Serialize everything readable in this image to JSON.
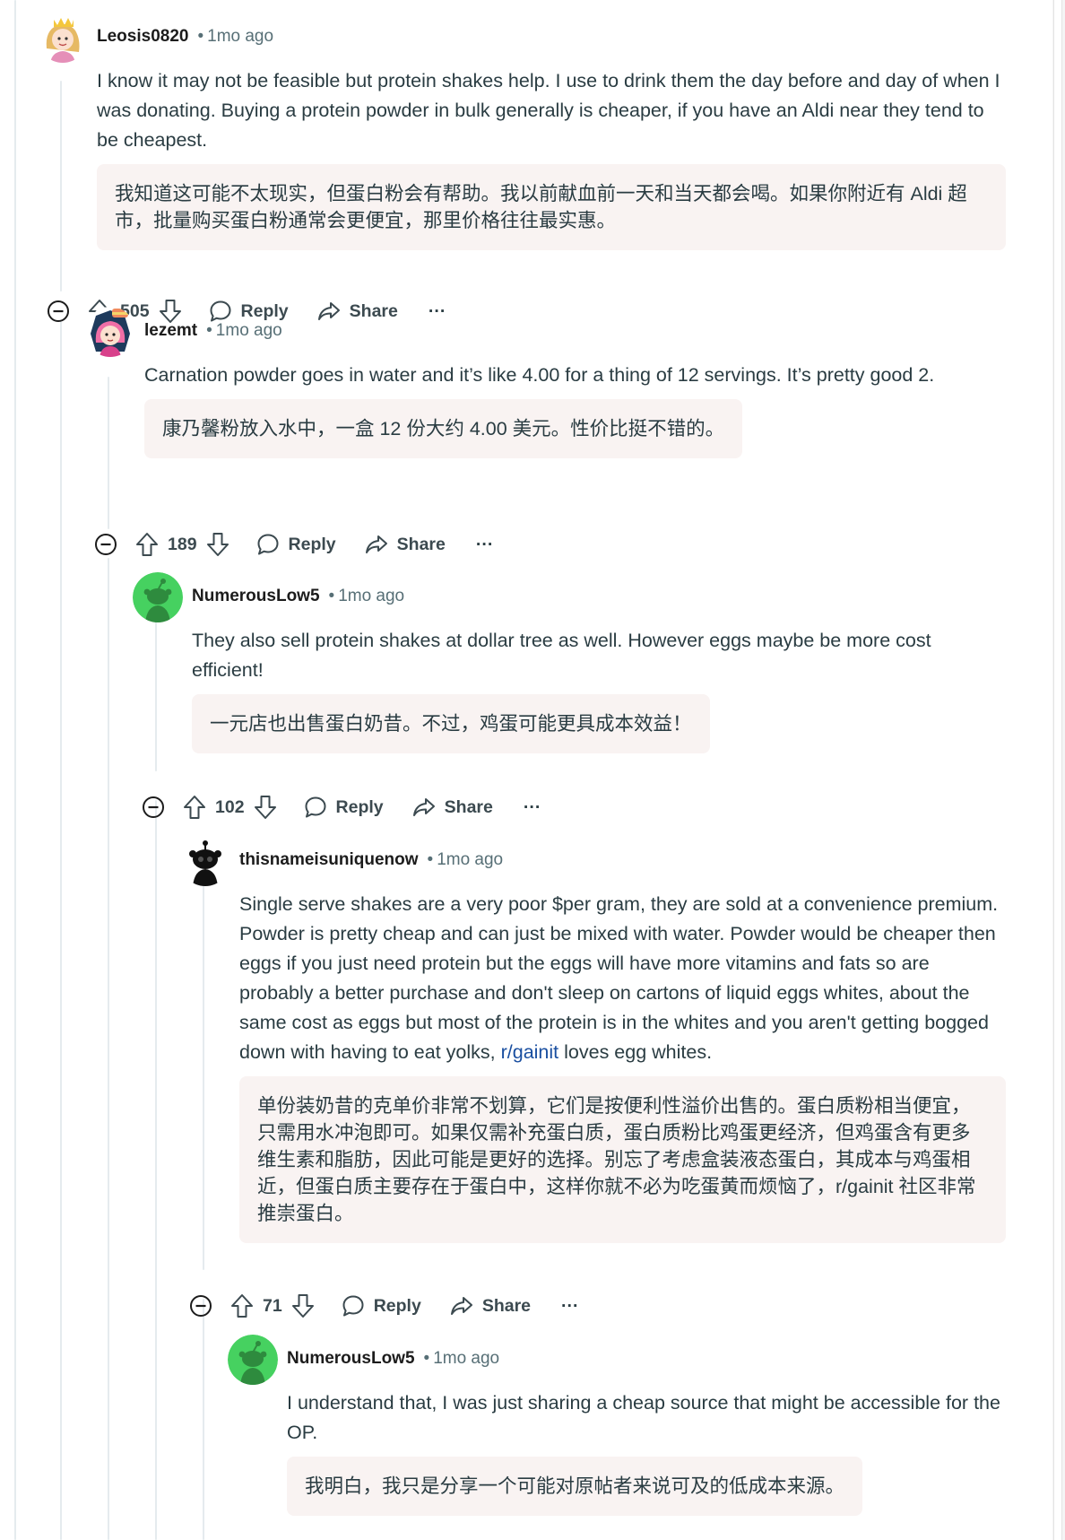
{
  "comments": [
    {
      "author": "Leosis0820",
      "time": "1mo ago",
      "avatar_icon": "princess-avatar-icon",
      "body": "I know it may not be feasible but protein shakes help. I use to drink them the day before and day of when I was donating. Buying a protein powder in bulk generally is cheaper, if you have an Aldi near they tend to be cheapest.",
      "translation": "我知道这可能不太现实，但蛋白粉会有帮助。我以前献血前一天和当天都会喝。如果你附近有 Aldi 超市，批量购买蛋白粉通常会更便宜，那里价格往往最实惠。",
      "votes": "505",
      "reply_label": "Reply",
      "share_label": "Share",
      "more_label": "···"
    },
    {
      "author": "lezemt",
      "time": "1mo ago",
      "avatar_icon": "pink-hair-avatar-icon",
      "body": "Carnation powder goes in water and it’s like 4.00 for a thing of 12 servings. It’s pretty good 2.",
      "translation": "康乃馨粉放入水中，一盒 12 份大约 4.00 美元。性价比挺不错的。",
      "votes": "189",
      "reply_label": "Reply",
      "share_label": "Share",
      "more_label": "···"
    },
    {
      "author": "NumerousLow5",
      "time": "1mo ago",
      "avatar_icon": "snoo-default-avatar-icon",
      "body": "They also sell protein shakes at dollar tree as well. However eggs maybe be more cost efficient!",
      "translation": "一元店也出售蛋白奶昔。不过，鸡蛋可能更具成本效益！",
      "votes": "102",
      "reply_label": "Reply",
      "share_label": "Share",
      "more_label": "···"
    },
    {
      "author": "thisnameisuniquenow",
      "time": "1mo ago",
      "avatar_icon": "dark-snoo-avatar-icon",
      "body_before_link": "Single serve shakes are a very poor $per gram, they are sold at a convenience premium. Powder is pretty cheap and can just be mixed with water. Powder would be cheaper then eggs if you just need protein but the eggs will have more vitamins and fats so are probably a better purchase and don't sleep on cartons of liquid eggs whites, about the same cost as eggs but most of the protein is in the whites and you aren't getting bogged down with having to eat yolks, ",
      "body_link": "r/gainit",
      "body_after_link": " loves egg whites.",
      "translation": "单份装奶昔的克单价非常不划算，它们是按便利性溢价出售的。蛋白质粉相当便宜，只需用水冲泡即可。如果仅需补充蛋白质，蛋白质粉比鸡蛋更经济，但鸡蛋含有更多维生素和脂肪，因此可能是更好的选择。别忘了考虑盒装液态蛋白，其成本与鸡蛋相近，但蛋白质主要存在于蛋白中，这样你就不必为吃蛋黄而烦恼了，r/gainit 社区非常推崇蛋白。",
      "votes": "71",
      "reply_label": "Reply",
      "share_label": "Share",
      "more_label": "···"
    },
    {
      "author": "NumerousLow5",
      "time": "1mo ago",
      "avatar_icon": "snoo-default-avatar-icon",
      "body": "I understand that, I was just sharing a cheap source that might be accessible for the OP.",
      "translation": "我明白，我只是分享一个可能对原帖者来说可及的低成本来源。"
    }
  ],
  "colors": {
    "accent_link": "#1a4fa0",
    "translation_bg": "#f9f3f2",
    "meta_text": "#576f76",
    "thread_line": "#e5ebee",
    "snoo_green": "#46d160"
  }
}
